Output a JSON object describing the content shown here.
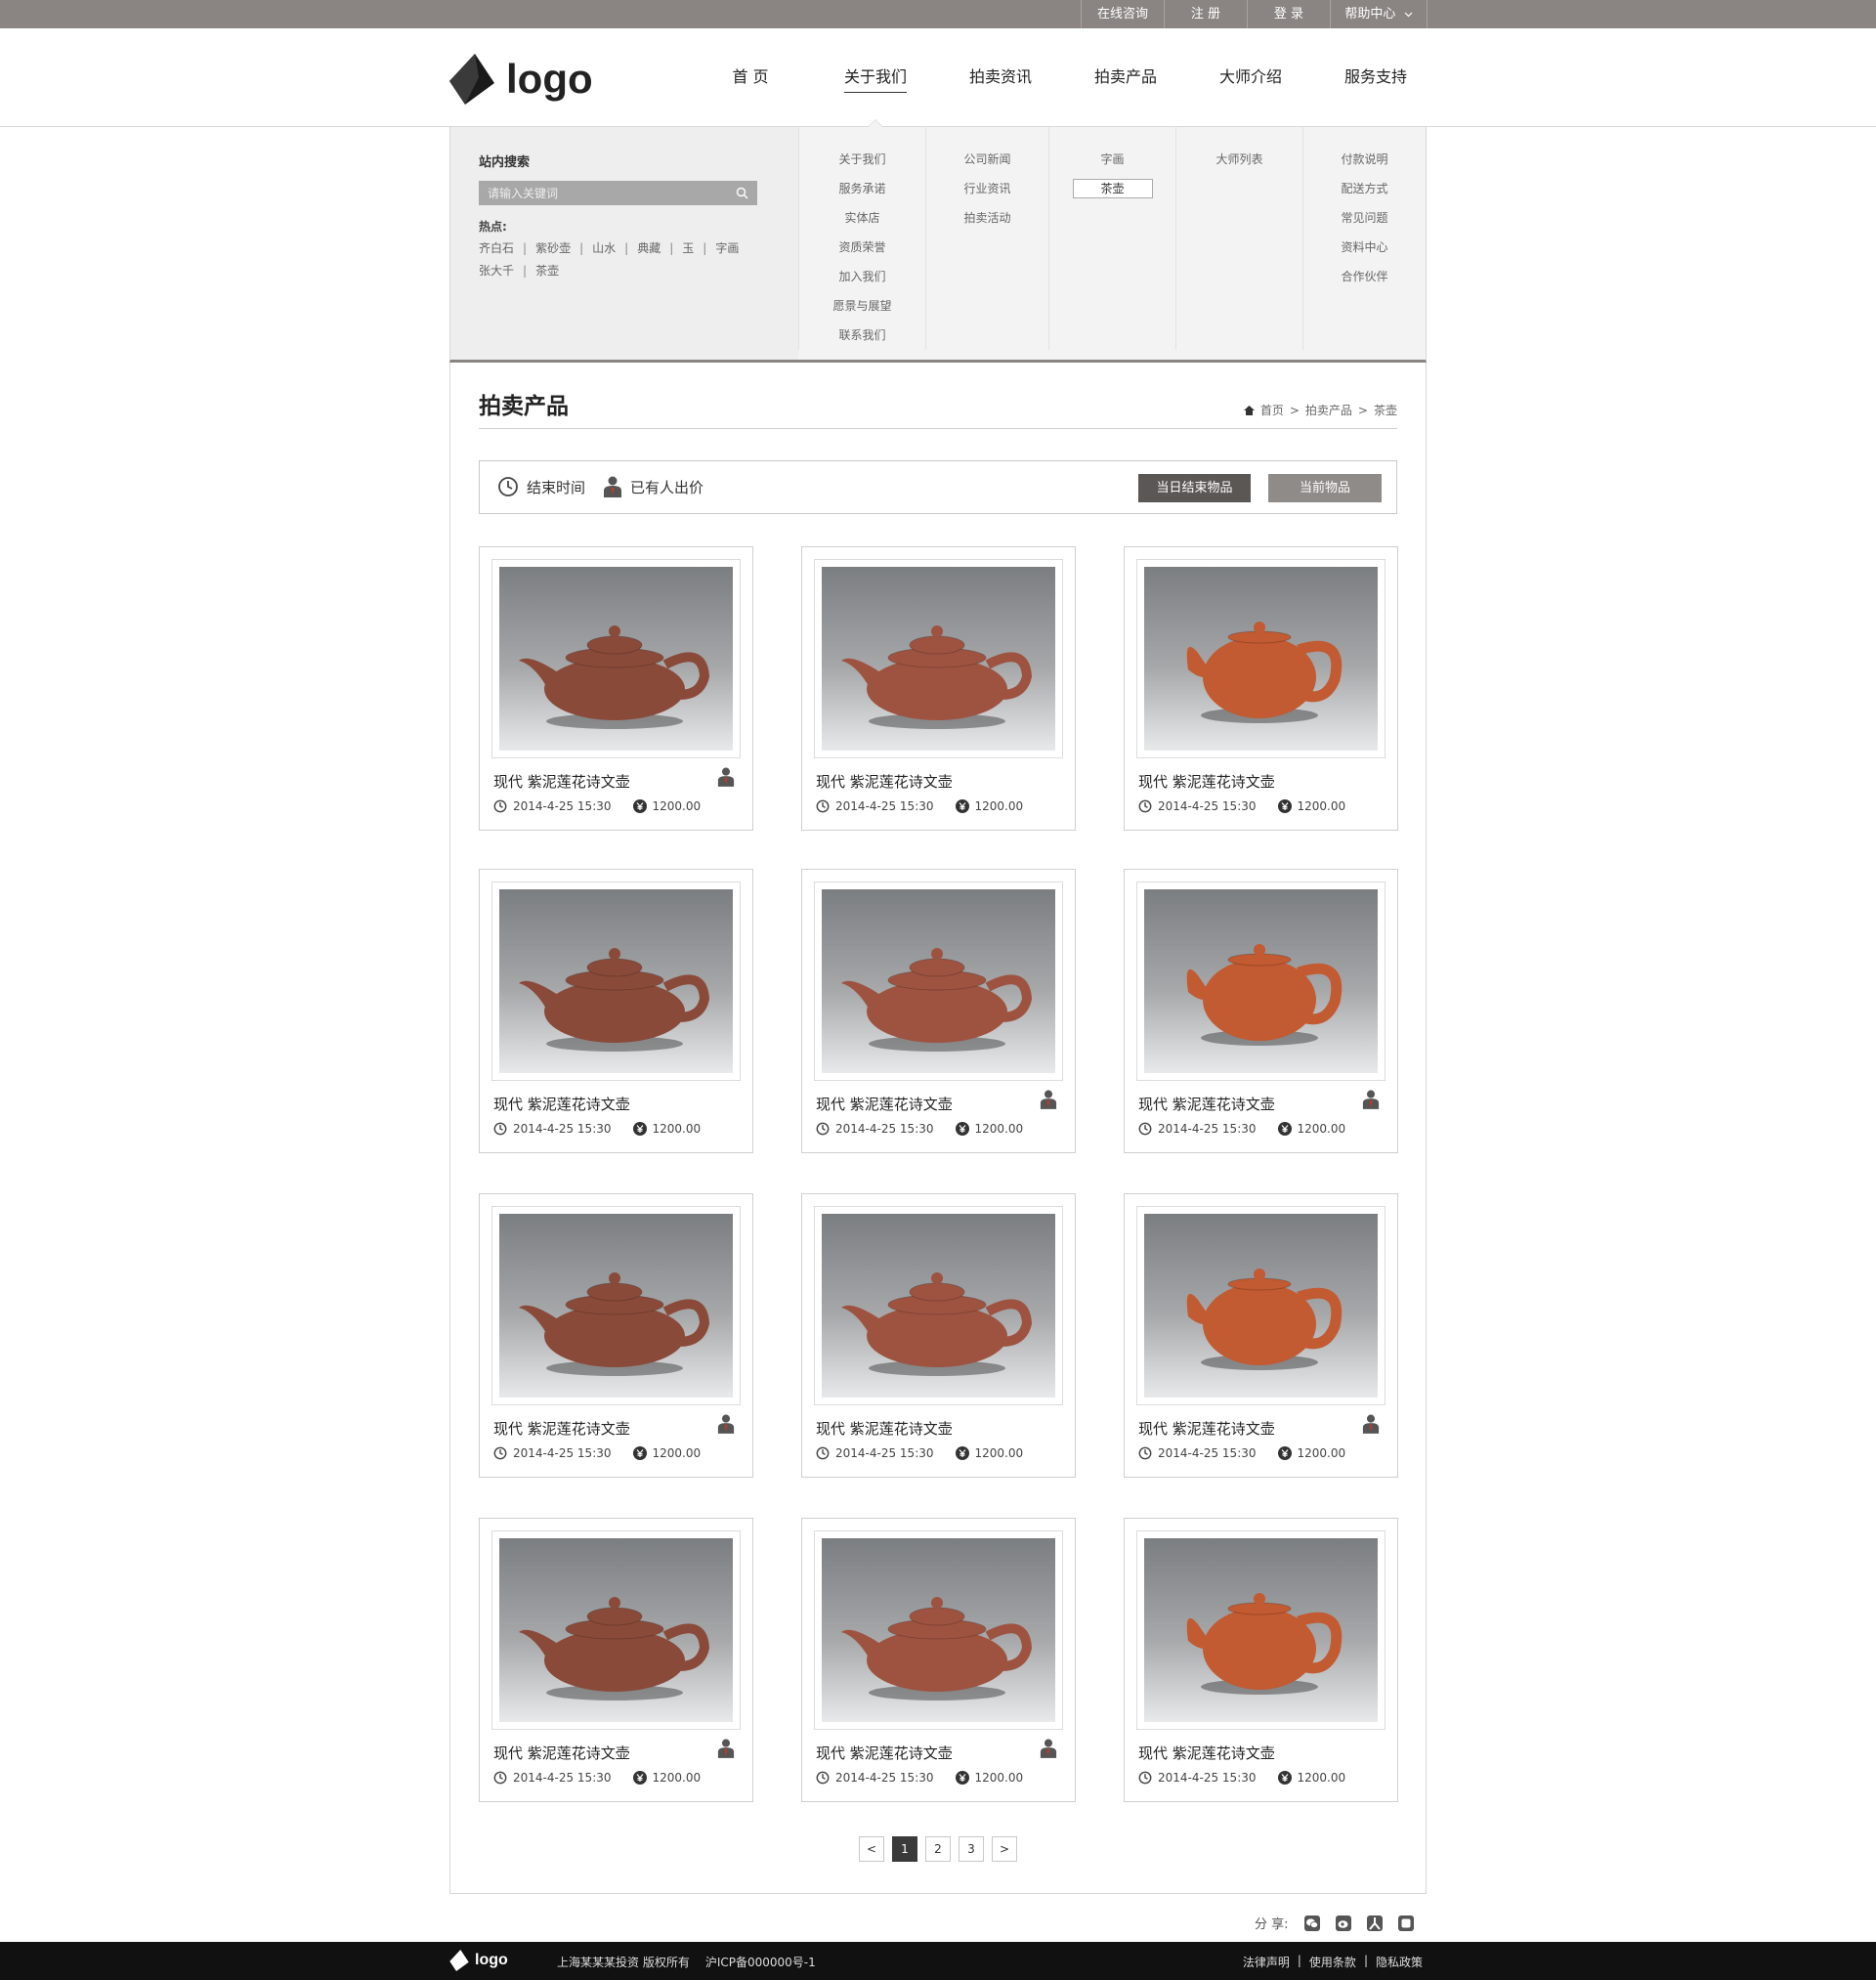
{
  "topbar": {
    "links": [
      "在线咨询",
      "注 册",
      "登 录",
      "帮助中心"
    ]
  },
  "header": {
    "logo_text": "logo",
    "nav": [
      "首 页",
      "关于我们",
      "拍卖资讯",
      "拍卖产品",
      "大师介绍",
      "服务支持"
    ],
    "active_nav": "关于我们"
  },
  "dropdown": {
    "search_title": "站内搜索",
    "search_placeholder": "请输入关键词",
    "hot_title": "热点:",
    "hot_tags": [
      "齐白石",
      "紫砂壶",
      "山水",
      "典藏",
      "玉",
      "字画",
      "张大千",
      "茶壶"
    ],
    "columns": [
      [
        "关于我们",
        "服务承诺",
        "实体店",
        "资质荣誉",
        "加入我们",
        "愿景与展望",
        "联系我们"
      ],
      [
        "公司新闻",
        "行业资讯",
        "拍卖活动"
      ],
      [
        "字画",
        "茶壶"
      ],
      [
        "大师列表"
      ],
      [
        "付款说明",
        "配送方式",
        "常见问题",
        "资料中心",
        "合作伙伴"
      ]
    ],
    "selected_item": "茶壶"
  },
  "main": {
    "title": "拍卖产品",
    "breadcrumb": [
      "首页",
      "拍卖产品",
      "茶壶"
    ],
    "legend_end_time": "结束时间",
    "legend_bid": "已有人出价",
    "btn_today": "当日结束物品",
    "btn_current": "当前物品"
  },
  "products": [
    {
      "name": "现代  紫泥莲花诗文壶",
      "time": "2014-4-25  15:30",
      "price": "1200.00",
      "bid": true
    },
    {
      "name": "现代  紫泥莲花诗文壶",
      "time": "2014-4-25  15:30",
      "price": "1200.00",
      "bid": false
    },
    {
      "name": "现代  紫泥莲花诗文壶",
      "time": "2014-4-25  15:30",
      "price": "1200.00",
      "bid": false
    },
    {
      "name": "现代  紫泥莲花诗文壶",
      "time": "2014-4-25  15:30",
      "price": "1200.00",
      "bid": false
    },
    {
      "name": "现代  紫泥莲花诗文壶",
      "time": "2014-4-25  15:30",
      "price": "1200.00",
      "bid": true
    },
    {
      "name": "现代  紫泥莲花诗文壶",
      "time": "2014-4-25  15:30",
      "price": "1200.00",
      "bid": true
    },
    {
      "name": "现代  紫泥莲花诗文壶",
      "time": "2014-4-25  15:30",
      "price": "1200.00",
      "bid": true
    },
    {
      "name": "现代  紫泥莲花诗文壶",
      "time": "2014-4-25  15:30",
      "price": "1200.00",
      "bid": false
    },
    {
      "name": "现代  紫泥莲花诗文壶",
      "time": "2014-4-25  15:30",
      "price": "1200.00",
      "bid": true
    },
    {
      "name": "现代  紫泥莲花诗文壶",
      "time": "2014-4-25  15:30",
      "price": "1200.00",
      "bid": true
    },
    {
      "name": "现代  紫泥莲花诗文壶",
      "time": "2014-4-25  15:30",
      "price": "1200.00",
      "bid": true
    },
    {
      "name": "现代  紫泥莲花诗文壶",
      "time": "2014-4-25  15:30",
      "price": "1200.00",
      "bid": false
    }
  ],
  "pagination": {
    "prev": "<",
    "pages": [
      "1",
      "2",
      "3"
    ],
    "current": "1",
    "next": ">"
  },
  "share": {
    "label": "分 享:",
    "icons": [
      "wechat-icon",
      "weibo-icon",
      "renren-icon",
      "qzone-icon"
    ]
  },
  "footer": {
    "logo_text": "logo",
    "company": "上海某某某投资  版权所有",
    "icp": "沪ICP备000000号-1",
    "links": [
      "法律声明",
      "使用条款",
      "隐私政策"
    ]
  },
  "colors": {
    "topbar": "#8a8582",
    "button_dark": "#5b5754",
    "button_light": "#8f8b88",
    "teapot_dark": "#8a4a3a",
    "teapot_mid": "#9e5341",
    "teapot_bright": "#c25a32",
    "footer_bg": "#111111"
  }
}
